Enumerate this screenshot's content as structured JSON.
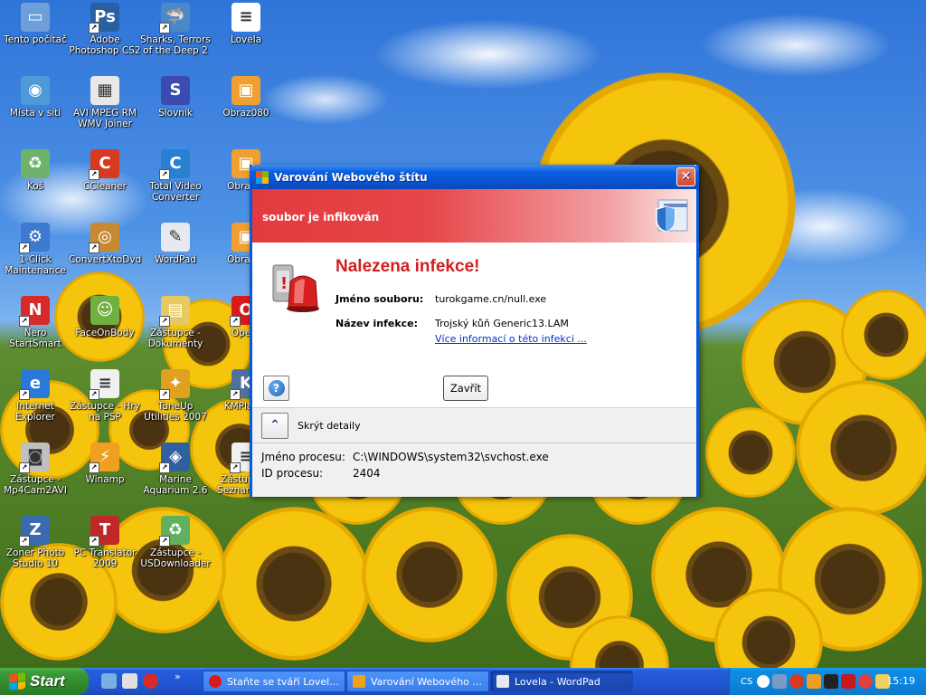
{
  "desktop": {
    "icons": [
      {
        "label": "Tento počítač",
        "icon": "my-computer-icon",
        "color": "#6e9fd8",
        "glyph": "▭"
      },
      {
        "label": "Adobe Photoshop CS2",
        "icon": "photoshop-icon",
        "color": "#2a5fa0",
        "glyph": "Ps"
      },
      {
        "label": "Sharks, Terrors of the Deep 2",
        "icon": "shark-game-icon",
        "color": "#4a88c8",
        "glyph": "🦈"
      },
      {
        "label": "Lovela",
        "icon": "document-icon",
        "color": "#ffffff",
        "glyph": "≡"
      },
      {
        "label": "Místa v síti",
        "icon": "network-places-icon",
        "color": "#4e9ad8",
        "glyph": "◉"
      },
      {
        "label": "AVI MPEG RM WMV Joiner",
        "icon": "video-joiner-icon",
        "color": "#e8e8e8",
        "glyph": "▦"
      },
      {
        "label": "Slovník",
        "icon": "dictionary-icon",
        "color": "#3a4cb0",
        "glyph": "S"
      },
      {
        "label": "Obraz080",
        "icon": "image-file-icon",
        "color": "#f0a030",
        "glyph": "▣"
      },
      {
        "label": "Koš",
        "icon": "recycle-bin-icon",
        "color": "#6fb26a",
        "glyph": "♻"
      },
      {
        "label": "CCleaner",
        "icon": "ccleaner-icon",
        "color": "#d83a20",
        "glyph": "C"
      },
      {
        "label": "Total Video Converter",
        "icon": "video-converter-icon",
        "color": "#2a80d0",
        "glyph": "C"
      },
      {
        "label": "Obraz…",
        "icon": "image-file-icon",
        "color": "#f0a030",
        "glyph": "▣"
      },
      {
        "label": "1-Click Maintenance",
        "icon": "maintenance-icon",
        "color": "#3f78d0",
        "glyph": "⚙"
      },
      {
        "label": "ConvertXtoDvd",
        "icon": "dvd-converter-icon",
        "color": "#c88a30",
        "glyph": "◎"
      },
      {
        "label": "WordPad",
        "icon": "wordpad-icon",
        "color": "#e8e8f0",
        "glyph": "✎"
      },
      {
        "label": "Obraz…",
        "icon": "image-file-icon",
        "color": "#f0a030",
        "glyph": "▣"
      },
      {
        "label": "Nero StartSmart",
        "icon": "nero-icon",
        "color": "#d82a2a",
        "glyph": "N"
      },
      {
        "label": "FaceOnBody",
        "icon": "face-on-body-icon",
        "color": "#70b040",
        "glyph": "☺"
      },
      {
        "label": "Zástupce - Dokumenty",
        "icon": "folder-shortcut-icon",
        "color": "#e8c860",
        "glyph": "▤"
      },
      {
        "label": "Opera",
        "icon": "opera-icon",
        "color": "#d81a1a",
        "glyph": "O"
      },
      {
        "label": "Internet Explorer",
        "icon": "internet-explorer-icon",
        "color": "#2a78d8",
        "glyph": "e"
      },
      {
        "label": "Zástupce - Hry na PSP",
        "icon": "document-shortcut-icon",
        "color": "#f0f0f0",
        "glyph": "≡"
      },
      {
        "label": "TuneUp Utilities 2007",
        "icon": "tuneup-icon",
        "color": "#e0a020",
        "glyph": "✦"
      },
      {
        "label": "KMPlayer",
        "icon": "kmplayer-icon",
        "color": "#5070a0",
        "glyph": "K"
      },
      {
        "label": "Zástupce - Mp4Cam2AVI",
        "icon": "camera-shortcut-icon",
        "color": "#c0c0c0",
        "glyph": "◙"
      },
      {
        "label": "Winamp",
        "icon": "winamp-icon",
        "color": "#f0a020",
        "glyph": "⚡"
      },
      {
        "label": "Marine Aquarium 2.6",
        "icon": "aquarium-icon",
        "color": "#3060a0",
        "glyph": "◈"
      },
      {
        "label": "Zástupce - Seznam D…",
        "icon": "document-shortcut-icon",
        "color": "#f0f0f0",
        "glyph": "≡"
      },
      {
        "label": "Zoner Photo Studio 10",
        "icon": "zoner-photo-icon",
        "color": "#3a6ab0",
        "glyph": "Z"
      },
      {
        "label": "PC Translator 2009",
        "icon": "pc-translator-icon",
        "color": "#c02828",
        "glyph": "T"
      },
      {
        "label": "Zástupce - USDownloader",
        "icon": "downloader-shortcut-icon",
        "color": "#60b060",
        "glyph": "♻"
      }
    ]
  },
  "dialog": {
    "title": "Varování Webového štítu",
    "close_glyph": "✕",
    "banner_text": "soubor je infikován",
    "heading": "Nalezena infekce!",
    "file_label": "Jméno souboru:",
    "file_value": "turokgame.cn/null.exe",
    "infection_label": "Název infekce:",
    "infection_value": "Trojský kůň Generic13.LAM",
    "more_info_link": "Více informací o této infekci ...",
    "help_glyph": "?",
    "close_button": "Zavřít",
    "toggle_glyph": "⌃",
    "toggle_label": "Skrýt detaily",
    "process_label": "Jméno procesu:",
    "process_value": "C:\\WINDOWS\\system32\\svchost.exe",
    "pid_label": "ID procesu:",
    "pid_value": "2404"
  },
  "taskbar": {
    "start_label": "Start",
    "quick_more": "»",
    "tasks": [
      {
        "label": "Staňte se tváří Lovel...",
        "icon": "opera-icon",
        "color": "#d81a1a",
        "active": false
      },
      {
        "label": "Varování Webového ...",
        "icon": "avast-shield-icon",
        "color": "#f0a020",
        "active": false
      },
      {
        "label": "Lovela - WordPad",
        "icon": "wordpad-icon",
        "color": "#e8e8f0",
        "active": true
      }
    ],
    "tray_lang": "CS",
    "clock": "15:19"
  },
  "colors": {
    "title_blue": "#0a53cf",
    "banner_red": "#e33a3e",
    "heading_red": "#d01f1f",
    "link_blue": "#0033cc",
    "start_green": "#3a9a36"
  }
}
